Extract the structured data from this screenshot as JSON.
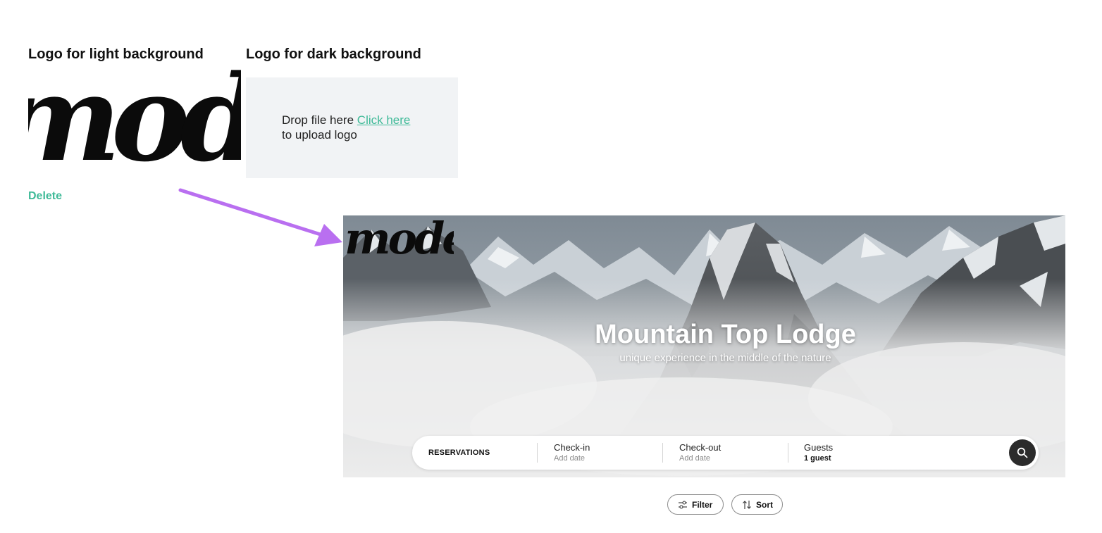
{
  "logo_settings": {
    "light": {
      "title": "Logo for light background",
      "logo_text": "moder",
      "delete_label": "Delete"
    },
    "dark": {
      "title": "Logo for dark background",
      "drop_text": "Drop file here",
      "link_label": "Click here",
      "after_link_text": "to upload logo"
    }
  },
  "preview": {
    "logo_text": "moder",
    "title": "Mountain Top Lodge",
    "subtitle": "unique experience in the middle of the nature",
    "reservation_bar": {
      "label": "RESERVATIONS",
      "checkin": {
        "label": "Check-in",
        "value": "Add date"
      },
      "checkout": {
        "label": "Check-out",
        "value": "Add date"
      },
      "guests": {
        "label": "Guests",
        "value": "1 guest"
      },
      "search_icon": "search-icon"
    }
  },
  "toolbar": {
    "filter_label": "Filter",
    "filter_icon": "sliders-icon",
    "sort_label": "Sort",
    "sort_icon": "sort-arrows-icon"
  },
  "colors": {
    "accent": "#3fba98",
    "arrow": "#b96ff0",
    "search_button": "#2b2b2b",
    "dropzone_bg": "#f1f3f5"
  }
}
